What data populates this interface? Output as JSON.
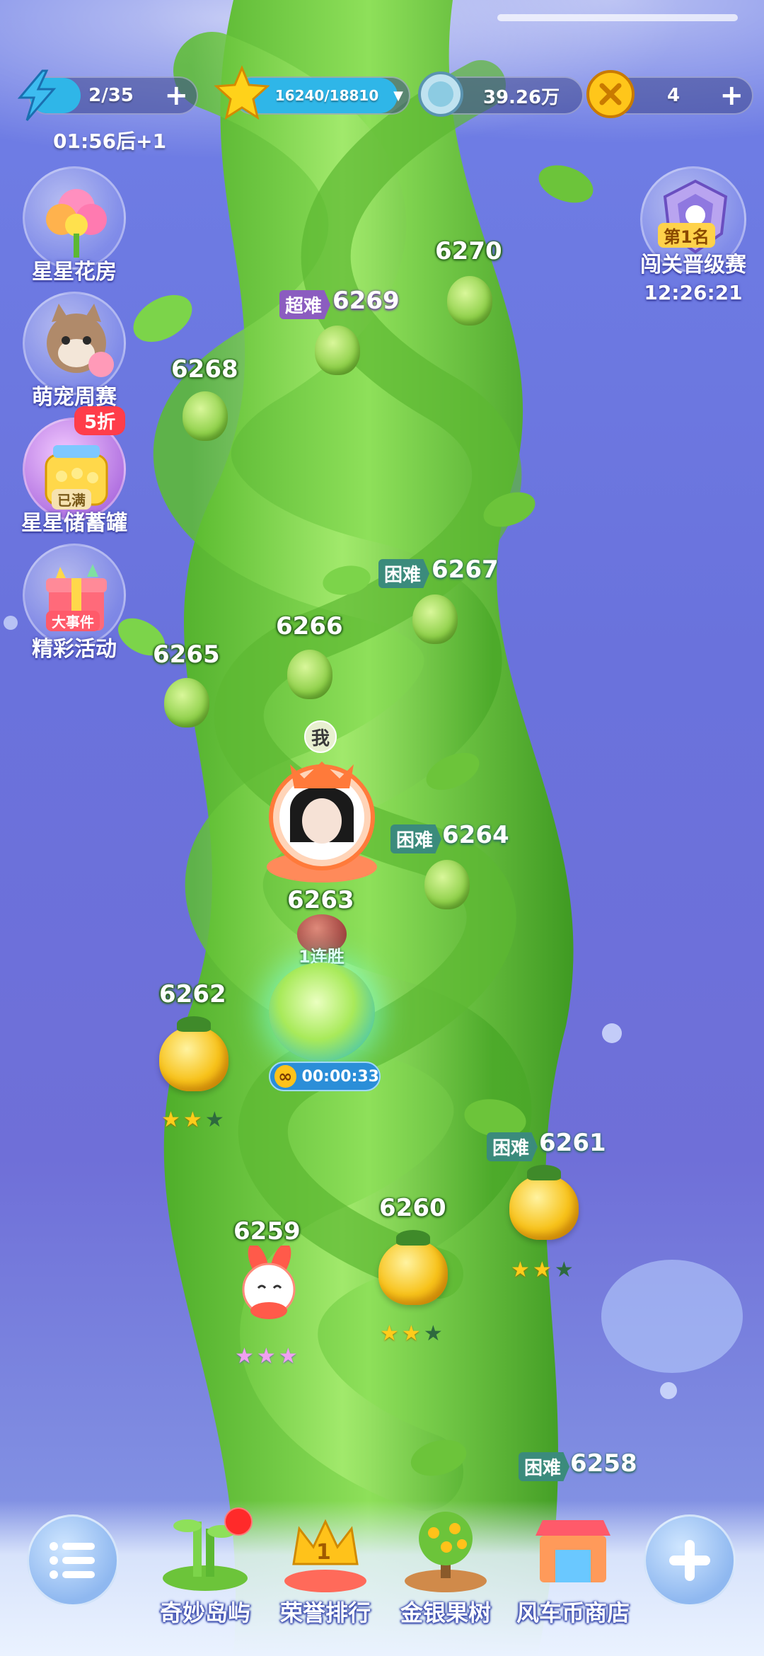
{
  "top_bar": {
    "energy": {
      "value": "2/35",
      "plus": "+",
      "icon": "lightning-icon"
    },
    "stars": {
      "value": "16240/18810",
      "dropdown": "▼",
      "icon": "star-icon"
    },
    "silver": {
      "value": "39.26万",
      "icon": "silver-coin-icon"
    },
    "gold": {
      "value": "4",
      "plus": "+",
      "icon": "gold-coin-icon"
    },
    "energy_timer": "01:56后+1"
  },
  "left_menu": [
    {
      "label": "星星花房",
      "icon": "flower-icon"
    },
    {
      "label": "萌宠周赛",
      "icon": "cat-icon"
    },
    {
      "label": "星星储蓄罐",
      "badge": "5折",
      "sub_badge": "已满",
      "icon": "piggy-bank-icon"
    },
    {
      "label": "精彩活动",
      "badge": "大事件",
      "icon": "gift-box-icon"
    }
  ],
  "right_event": {
    "rank": "第1名",
    "label": "闯关晋级赛",
    "timer": "12:26:21",
    "icon": "trophy-badge-icon"
  },
  "levels": [
    {
      "num": "6270"
    },
    {
      "num": "6269",
      "difficulty": "超难"
    },
    {
      "num": "6268"
    },
    {
      "num": "6267",
      "difficulty": "困难"
    },
    {
      "num": "6266"
    },
    {
      "num": "6265"
    },
    {
      "num": "6264",
      "difficulty": "困难"
    },
    {
      "num": "6263",
      "streak": "1连胜",
      "countdown": "00:00:33",
      "infinite": "∞"
    },
    {
      "num": "6262",
      "stars_earned": 2
    },
    {
      "num": "6261",
      "difficulty": "困难",
      "stars_earned": 2
    },
    {
      "num": "6260",
      "stars_earned": 2
    },
    {
      "num": "6259",
      "stars_earned": 3
    },
    {
      "num": "6258",
      "difficulty": "困难"
    }
  ],
  "player": {
    "me_label": "我"
  },
  "dock": [
    {
      "label": "奇妙岛屿",
      "icon": "bamboo-island-icon",
      "has_dot": true
    },
    {
      "label": "荣誉排行",
      "icon": "crown-icon",
      "rank_digit": "1"
    },
    {
      "label": "金银果树",
      "icon": "fruit-tree-icon"
    },
    {
      "label": "风车币商店",
      "icon": "shop-icon"
    }
  ],
  "colors": {
    "background": "#6f72dc",
    "stalk": "#6cc63a",
    "hard_tag": "#3b8b7c",
    "super_tag": "#8b5cc0",
    "energy_bar": "#2fb6e8",
    "star_bar": "#2fb6e8"
  }
}
